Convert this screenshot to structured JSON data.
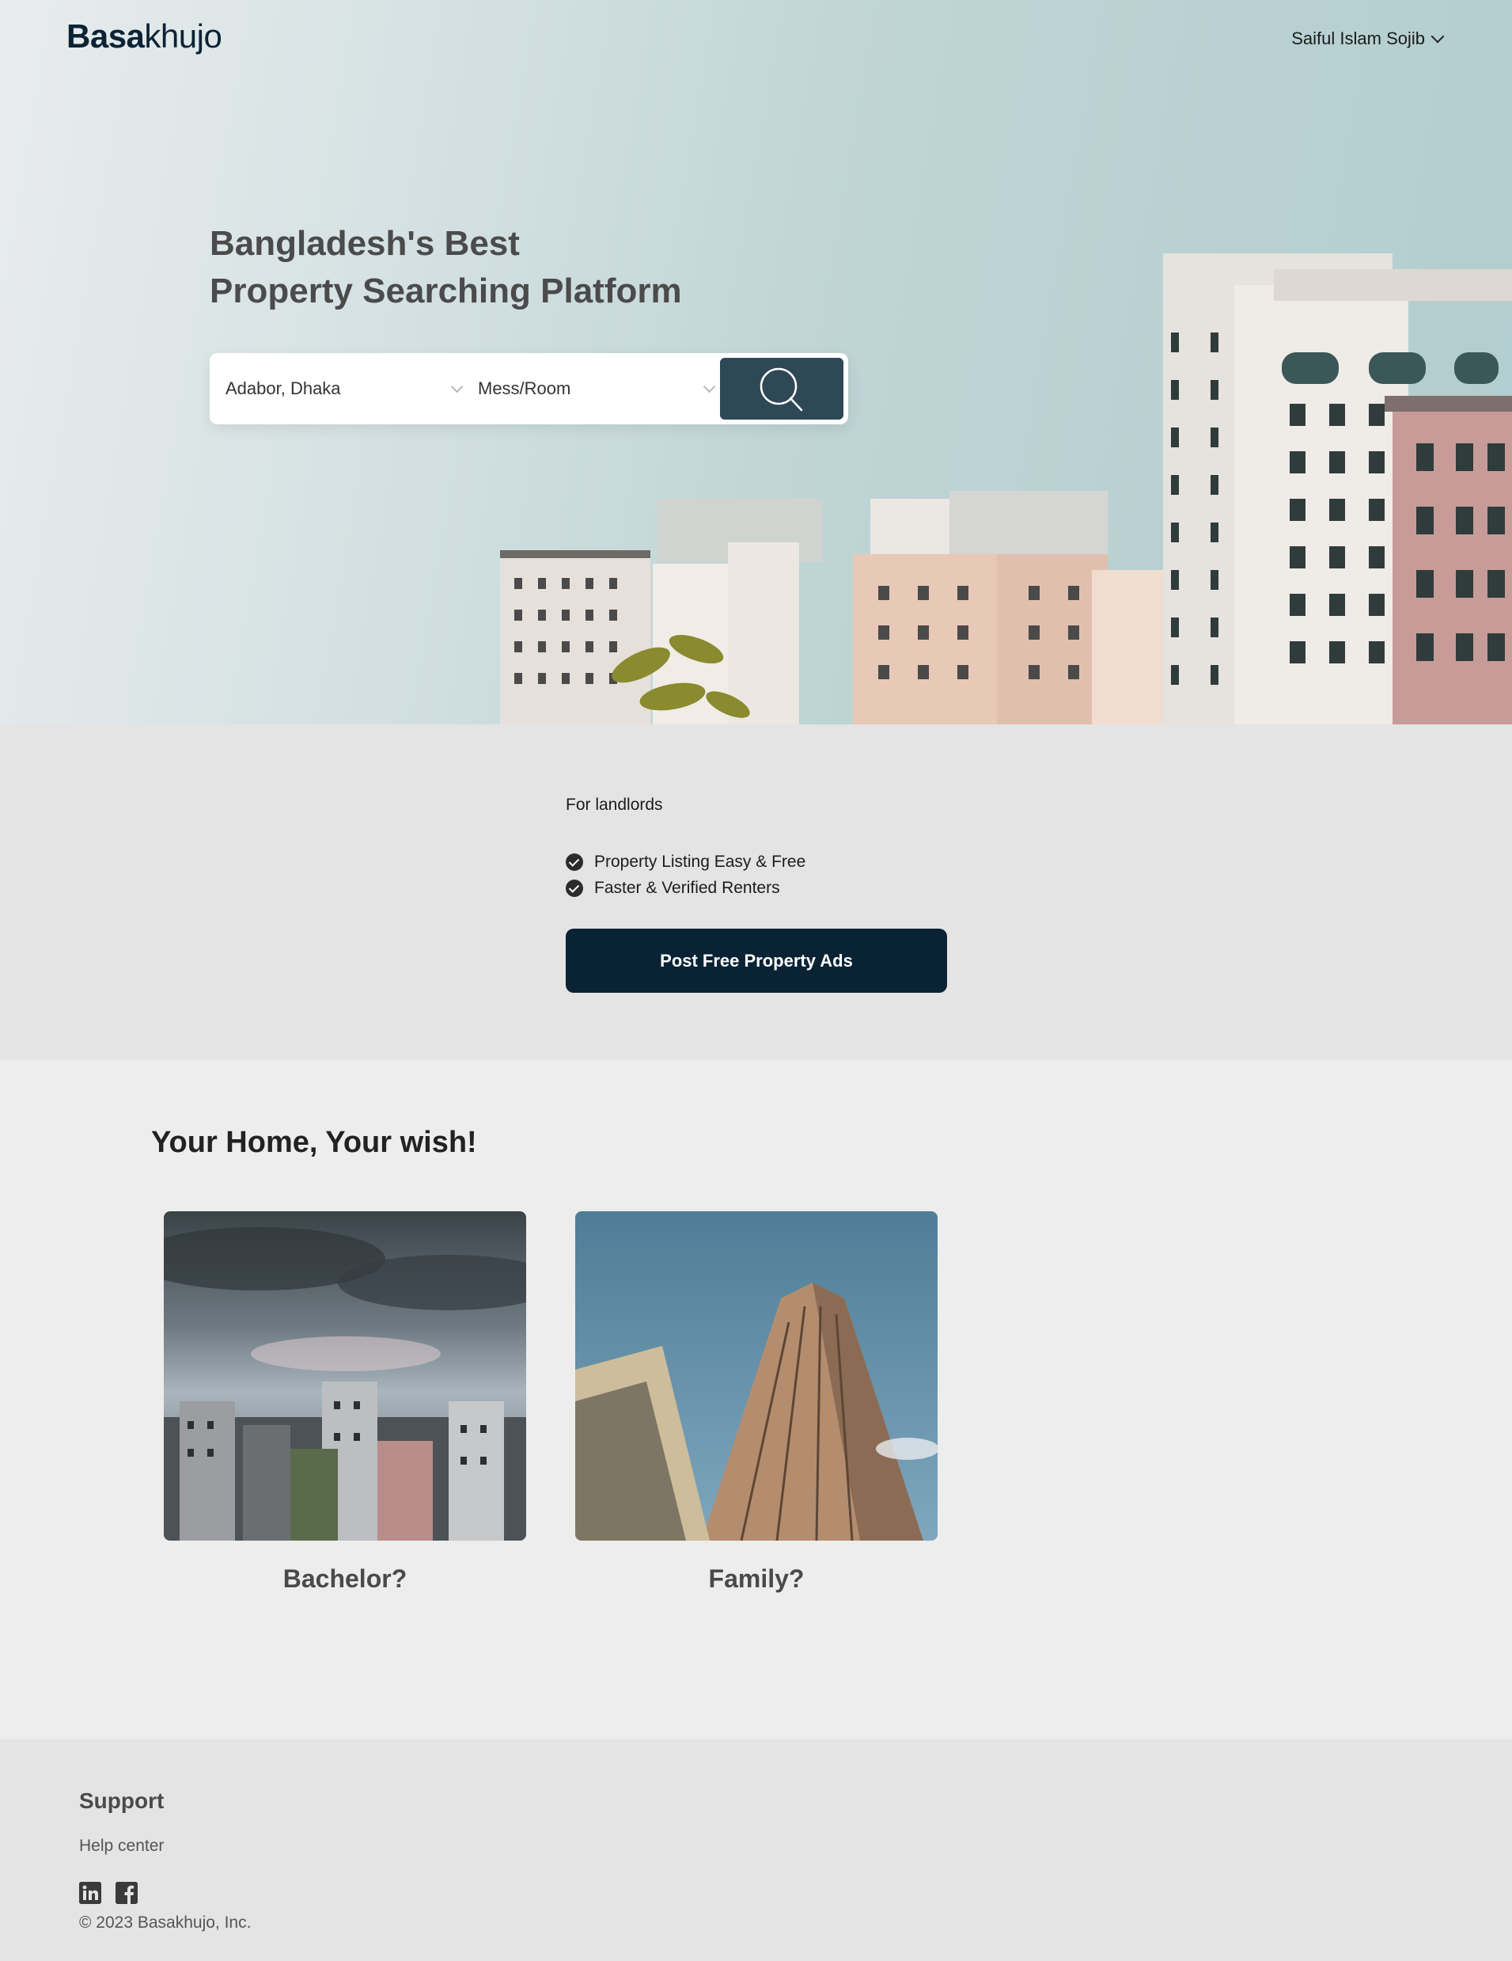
{
  "header": {
    "logo_bold": "Basa",
    "logo_light": "khujo",
    "user_name": "Saiful Islam Sojib"
  },
  "hero": {
    "title_line1": "Bangladesh's Best",
    "title_line2": "Property Searching Platform",
    "location_value": "Adabor, Dhaka",
    "type_value": "Mess/Room",
    "search_icon": "search-icon"
  },
  "landlord": {
    "heading": "For landlords",
    "features": [
      "Property Listing Easy & Free",
      "Faster & Verified Renters"
    ],
    "cta_label": "Post Free Property Ads"
  },
  "wish": {
    "title": "Your Home, Your wish!",
    "cards": [
      {
        "label": "Bachelor?"
      },
      {
        "label": "Family?"
      }
    ]
  },
  "footer": {
    "support_heading": "Support",
    "help_link": "Help center",
    "social_icons": [
      "linkedin-icon",
      "facebook-icon"
    ],
    "copyright": "© 2023 Basakhujo, Inc."
  },
  "colors": {
    "brand_dark": "#0a2334",
    "search_button": "#2f4857",
    "hero_sky": "#b2cdcf"
  }
}
